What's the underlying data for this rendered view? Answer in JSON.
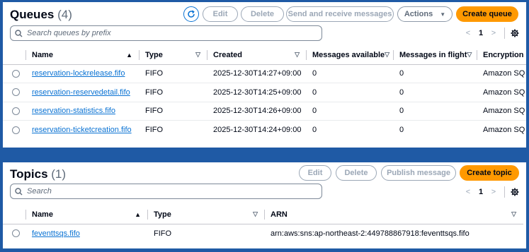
{
  "queues": {
    "title": "Queues",
    "count": "(4)",
    "buttons": {
      "edit": "Edit",
      "delete": "Delete",
      "send_receive": "Send and receive messages",
      "actions": "Actions",
      "create": "Create queue"
    },
    "search_placeholder": "Search queues by prefix",
    "page": "1",
    "columns": [
      "Name",
      "Type",
      "Created",
      "Messages available",
      "Messages in flight",
      "Encryption"
    ],
    "rows": [
      {
        "name": "reservation-lockrelease.fifo",
        "type": "FIFO",
        "created": "2025-12-30T14:27+09:00",
        "available": "0",
        "in_flight": "0",
        "encryption": "Amazon SQ"
      },
      {
        "name": "reservation-reservedetail.fifo",
        "type": "FIFO",
        "created": "2025-12-30T14:25+09:00",
        "available": "0",
        "in_flight": "0",
        "encryption": "Amazon SQ"
      },
      {
        "name": "reservation-statistics.fifo",
        "type": "FIFO",
        "created": "2025-12-30T14:26+09:00",
        "available": "0",
        "in_flight": "0",
        "encryption": "Amazon SQ"
      },
      {
        "name": "reservation-ticketcreation.fifo",
        "type": "FIFO",
        "created": "2025-12-30T14:24+09:00",
        "available": "0",
        "in_flight": "0",
        "encryption": "Amazon SQ"
      }
    ]
  },
  "topics": {
    "title": "Topics",
    "count": "(1)",
    "buttons": {
      "edit": "Edit",
      "delete": "Delete",
      "publish": "Publish message",
      "create": "Create topic"
    },
    "search_placeholder": "Search",
    "page": "1",
    "columns": [
      "Name",
      "Type",
      "ARN"
    ],
    "rows": [
      {
        "name": "feventtsqs.fifo",
        "type": "FIFO",
        "arn": "arn:aws:sns:ap-northeast-2:449788867918:feventtsqs.fifo"
      }
    ]
  },
  "colors": {
    "accent": "#ff9900",
    "link": "#0972d3",
    "disabled": "#9ba7b6",
    "frame": "#1f5aa5"
  },
  "icons": [
    "refresh-icon",
    "search-icon",
    "chevron-left-icon",
    "chevron-right-icon",
    "gear-icon",
    "sort-icon",
    "caret-down-icon"
  ]
}
